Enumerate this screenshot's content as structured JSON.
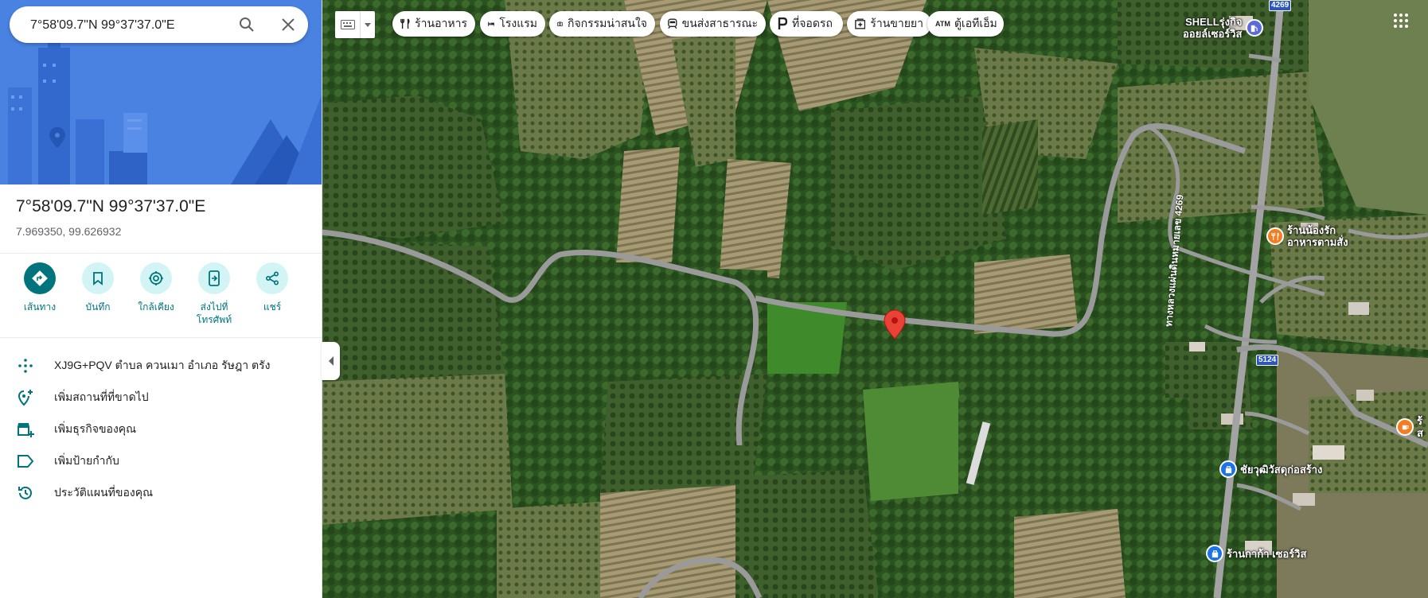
{
  "search": {
    "value": "7°58'09.7\"N 99°37'37.0\"E"
  },
  "place": {
    "title": "7°58'09.7\"N 99°37'37.0\"E",
    "coords": "7.969350, 99.626932"
  },
  "actions": [
    {
      "label": "เส้นทาง",
      "icon": "directions-icon"
    },
    {
      "label": "บันทึก",
      "icon": "bookmark-icon"
    },
    {
      "label": "ใกล้เคียง",
      "icon": "nearby-icon"
    },
    {
      "label": "ส่งไปที่\nโทรศัพท์",
      "icon": "send-to-phone-icon"
    },
    {
      "label": "แชร์",
      "icon": "share-icon"
    }
  ],
  "info": [
    {
      "text": "XJ9G+PQV ตำบล ควนเมา อำเภอ รัษฎา ตรัง",
      "icon": "plus-code-icon"
    },
    {
      "text": "เพิ่มสถานที่ที่ขาดไป",
      "icon": "add-place-icon"
    },
    {
      "text": "เพิ่มธุรกิจของคุณ",
      "icon": "add-business-icon"
    },
    {
      "text": "เพิ่มป้ายกำกับ",
      "icon": "label-icon"
    },
    {
      "text": "ประวัติแผนที่ของคุณ",
      "icon": "history-icon"
    }
  ],
  "chips": [
    {
      "label": "ร้านอาหาร",
      "icon": "restaurant-icon"
    },
    {
      "label": "โรงแรม",
      "icon": "hotel-icon"
    },
    {
      "label": "กิจกรรมน่าสนใจ",
      "icon": "camera-icon"
    },
    {
      "label": "ขนส่งสาธารณะ",
      "icon": "transit-icon"
    },
    {
      "label": "ที่จอดรถ",
      "icon": "parking-icon"
    },
    {
      "label": "ร้านขายยา",
      "icon": "pharmacy-icon"
    },
    {
      "label": "ตู้เอทีเอ็ม",
      "icon": "atm-icon"
    }
  ],
  "pois": [
    {
      "label": "SHELLรุ่งกิจ\nออยล์เซอร์วิส",
      "icon": "gas-station-icon",
      "color": "#5b6bd8"
    },
    {
      "label": "ร้านน้องรัก\nอาหารตามสั่ง",
      "icon": "restaurant-icon",
      "color": "#f57c1f"
    },
    {
      "label": "ชัยวุฒิวัสดุก่อสร้าง",
      "icon": "shopping-bag-icon",
      "color": "#1a73e8"
    },
    {
      "label": "ร้านกาก้า เซอร์วิส",
      "icon": "shopping-bag-icon",
      "color": "#1a73e8"
    },
    {
      "label": "ร้\nส",
      "icon": "cafe-icon",
      "color": "#f57c1f"
    }
  ],
  "road_labels": {
    "highway": "ทางหลวงแผ่นดินหมายเลข 4269",
    "shield_top": "4269",
    "shield_5124": "5124"
  },
  "colors": {
    "accent": "#00747c",
    "accent_light": "#d2f4f5",
    "pin": "#ea4335"
  }
}
